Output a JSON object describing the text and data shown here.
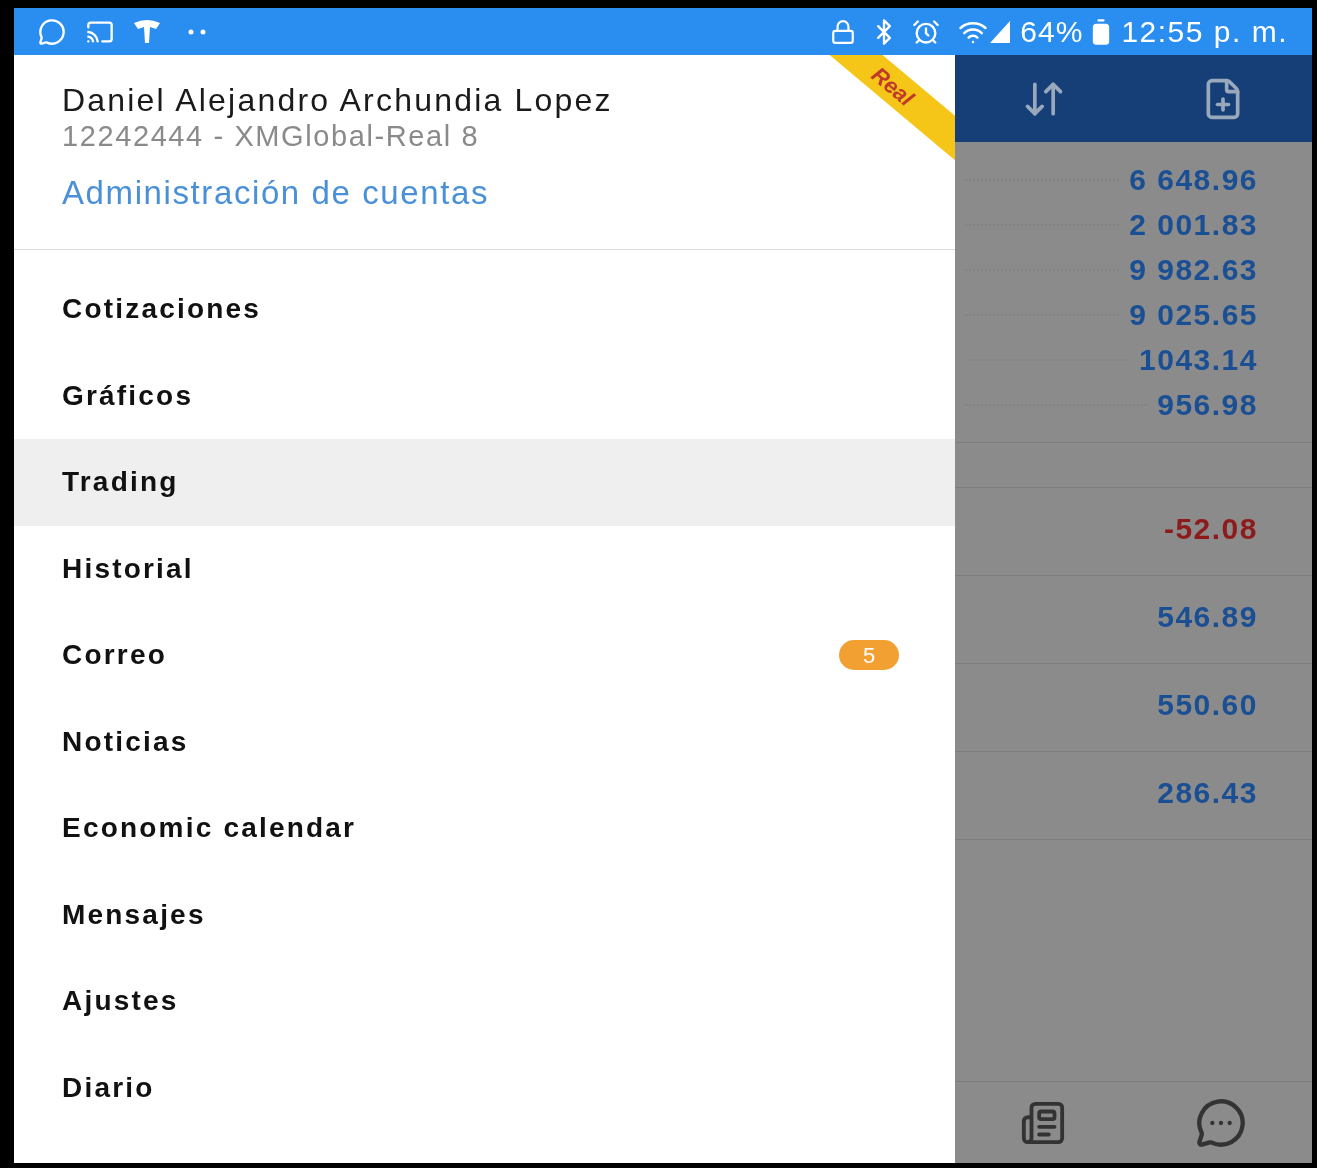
{
  "status_bar": {
    "battery": "64%",
    "time": "12:55 p. m."
  },
  "account": {
    "name": "Daniel Alejandro Archundia Lopez",
    "number": "12242444 - XMGlobal-Real 8",
    "manage_link": "Administración de cuentas",
    "ribbon": "Real"
  },
  "menu": [
    {
      "label": "Cotizaciones",
      "selected": false
    },
    {
      "label": "Gráficos",
      "selected": false
    },
    {
      "label": "Trading",
      "selected": true
    },
    {
      "label": "Historial",
      "selected": false
    },
    {
      "label": "Correo",
      "selected": false,
      "badge": "5"
    },
    {
      "label": "Noticias",
      "selected": false
    },
    {
      "label": "Economic calendar",
      "selected": false
    },
    {
      "label": "Mensajes",
      "selected": false
    },
    {
      "label": "Ajustes",
      "selected": false
    },
    {
      "label": "Diario",
      "selected": false
    }
  ],
  "background": {
    "balances": [
      {
        "value": "6 648.96",
        "color": "#1a4f94"
      },
      {
        "value": "2 001.83",
        "color": "#1a4f94"
      },
      {
        "value": "9 982.63",
        "color": "#1a4f94"
      },
      {
        "value": "9 025.65",
        "color": "#1a4f94"
      },
      {
        "value": "1043.14",
        "color": "#1a4f94"
      },
      {
        "value": "956.98",
        "color": "#1a4f94"
      }
    ],
    "positions": [
      {
        "value": "-52.08",
        "color": "#8e1b1b"
      },
      {
        "value": "546.89",
        "color": "#1a4f94"
      },
      {
        "value": "550.60",
        "color": "#1a4f94"
      },
      {
        "value": "286.43",
        "color": "#1a4f94"
      }
    ]
  }
}
